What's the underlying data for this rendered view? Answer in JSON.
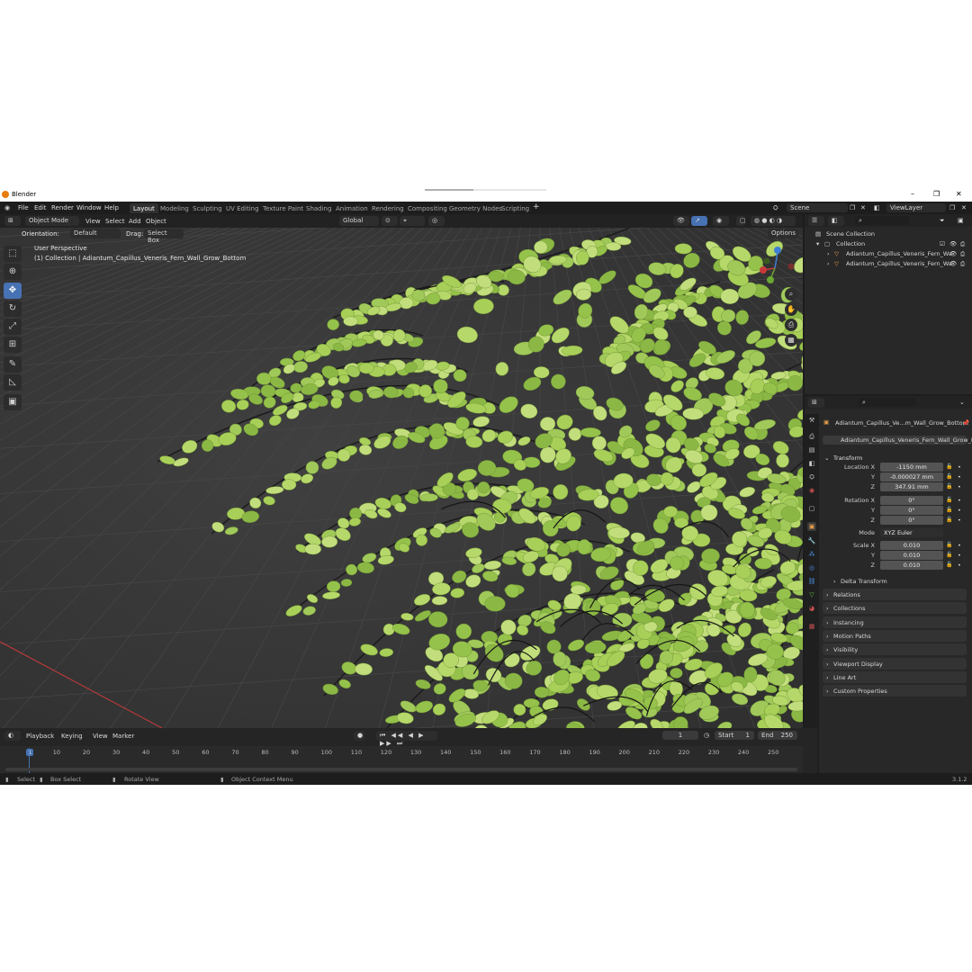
{
  "window": {
    "title": "Blender",
    "progress": 0.4,
    "version": "3.1.2"
  },
  "menu": [
    "File",
    "Edit",
    "Render",
    "Window",
    "Help"
  ],
  "workspaces": [
    "Layout",
    "Modeling",
    "Sculpting",
    "UV Editing",
    "Texture Paint",
    "Shading",
    "Animation",
    "Rendering",
    "Compositing",
    "Geometry Nodes",
    "Scripting"
  ],
  "active_workspace": "Layout",
  "scene": {
    "name": "Scene",
    "view_layer": "ViewLayer"
  },
  "viewport_header": {
    "mode": "Object Mode",
    "menus": [
      "View",
      "Select",
      "Add",
      "Object"
    ],
    "transform_orientation": "Global",
    "options": "Options"
  },
  "tool_settings": {
    "orientation_label": "Orientation:",
    "orientation_value": "Default",
    "drag_label": "Drag:",
    "drag_value": "Select Box"
  },
  "viewport": {
    "perspective": "User Perspective",
    "object_info": "(1) Collection | Adiantum_Capillus_Veneris_Fern_Wall_Grow_Bottom"
  },
  "outliner": {
    "root": "Scene Collection",
    "collection": "Collection",
    "items": [
      "Adiantum_Capillus_Veneris_Fern_Wa",
      "Adiantum_Capillus_Veneris_Fern_Wa"
    ]
  },
  "properties": {
    "object_name": "Adiantum_Capillus_Ve...m_Wall_Grow_Bottom",
    "data_name": "Adiantum_Capillus_Veneris_Fern_Wall_Grow_B...",
    "transform_title": "Transform",
    "location_label": "Location X",
    "location": [
      "-1150 mm",
      "-0.000027 mm",
      "347.91 mm"
    ],
    "rotation_label": "Rotation X",
    "rotation": [
      "0°",
      "0°",
      "0°"
    ],
    "mode_label": "Mode",
    "mode_value": "XYZ Euler",
    "scale_label": "Scale X",
    "scale": [
      "0.010",
      "0.010",
      "0.010"
    ],
    "axis_y": "Y",
    "axis_z": "Z",
    "delta": "Delta Transform",
    "panels": [
      "Relations",
      "Collections",
      "Instancing",
      "Motion Paths",
      "Visibility",
      "Viewport Display",
      "Line Art",
      "Custom Properties"
    ]
  },
  "timeline": {
    "menus": [
      "Playback",
      "Keying",
      "View",
      "Marker"
    ],
    "current_frame": "1",
    "start_label": "Start",
    "start": "1",
    "end_label": "End",
    "end": "250",
    "ticks": [
      "1",
      "10",
      "20",
      "30",
      "40",
      "50",
      "60",
      "70",
      "80",
      "90",
      "100",
      "110",
      "120",
      "130",
      "140",
      "150",
      "160",
      "170",
      "180",
      "190",
      "200",
      "210",
      "220",
      "230",
      "240",
      "250"
    ]
  },
  "statusbar": [
    "Select",
    "Box Select",
    "Rotate View",
    "Object Context Menu"
  ],
  "colors": {
    "accent": "#4772b3",
    "leaf": "#a6cc55",
    "stem": "#1a1a1a",
    "x_axis": "#c83a3a",
    "object_orange": "#e8a04a"
  }
}
